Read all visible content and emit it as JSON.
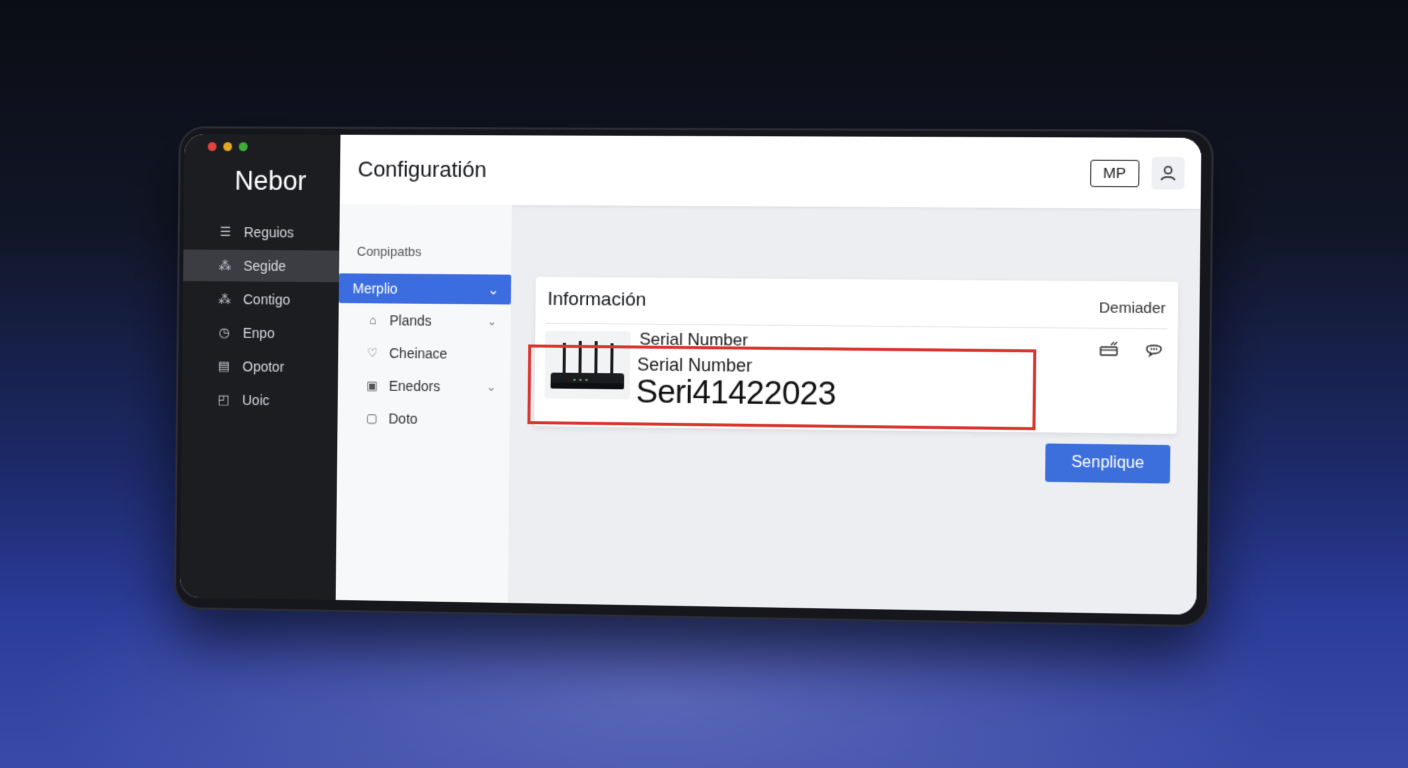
{
  "app": {
    "name": "Nebor"
  },
  "sidebar": {
    "items": [
      {
        "label": "Reguios",
        "icon": "menu-icon"
      },
      {
        "label": "Segide",
        "icon": "network-icon",
        "active": true
      },
      {
        "label": "Contigo",
        "icon": "network-icon"
      },
      {
        "label": "Enpo",
        "icon": "clock-icon"
      },
      {
        "label": "Opotor",
        "icon": "document-icon"
      },
      {
        "label": "Uoic",
        "icon": "shield-icon"
      }
    ]
  },
  "header": {
    "title": "Configuratión",
    "badge": "MP",
    "user_icon": "user-icon"
  },
  "subnav": {
    "section_label": "Conpipatbs",
    "selected": "Merplio",
    "items": [
      {
        "label": "Plands",
        "icon": "home-icon",
        "has_chevron": true
      },
      {
        "label": "Cheinace",
        "icon": "heart-icon",
        "has_chevron": false
      },
      {
        "label": "Enedors",
        "icon": "grid-icon",
        "has_chevron": true
      },
      {
        "label": "Doto",
        "icon": "file-icon",
        "has_chevron": false
      }
    ]
  },
  "info_card": {
    "title": "Información",
    "right_label": "Demiader",
    "serial_label_1": "Serial Number",
    "serial_label_2": "Serial Number",
    "serial_value": "Seri41422023",
    "icons": [
      "device-icon",
      "chat-icon"
    ]
  },
  "actions": {
    "primary_label": "Senplique"
  },
  "colors": {
    "accent": "#3b6de0",
    "highlight": "#d8362e",
    "sidebar_bg": "#1c1d21"
  }
}
